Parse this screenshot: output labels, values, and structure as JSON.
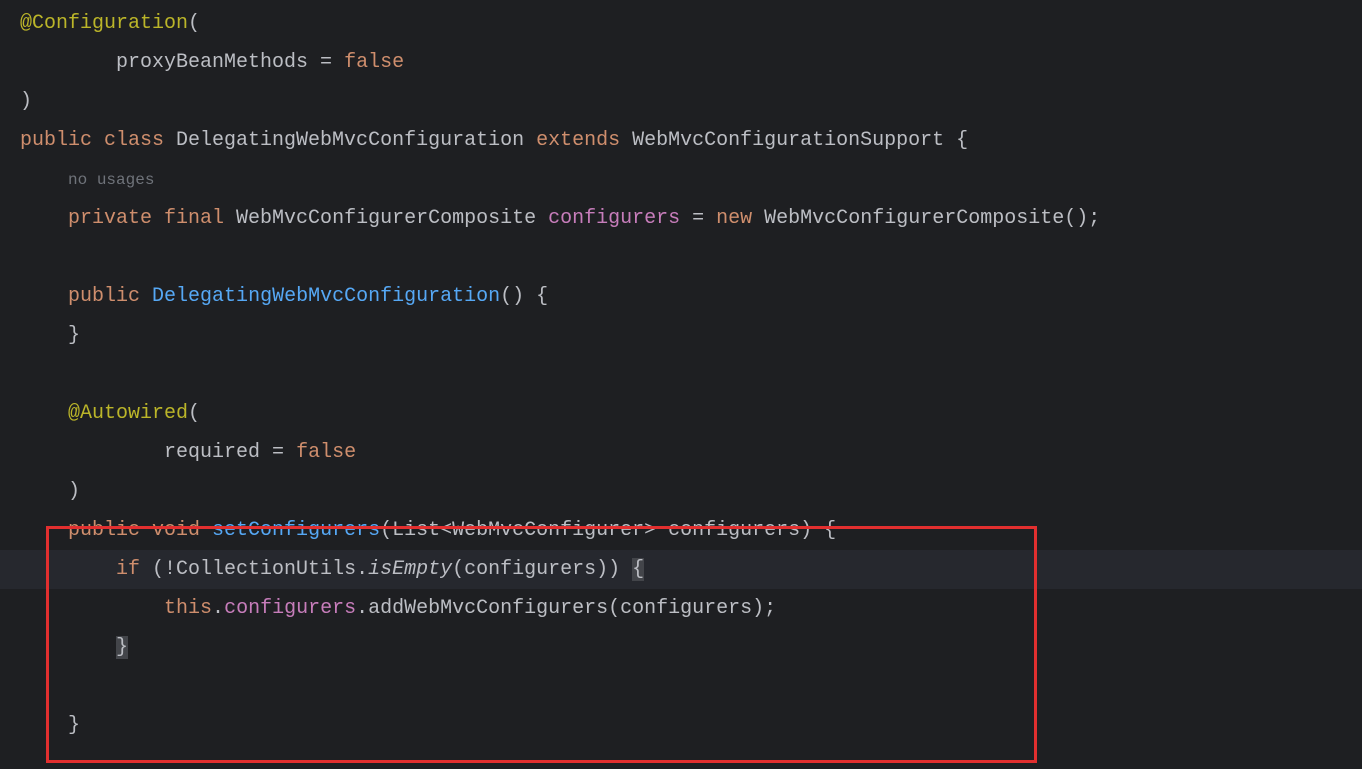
{
  "code": {
    "l1_annotation": "@Configuration",
    "l1_paren": "(",
    "l2_indent": "        ",
    "l2_prop": "proxyBeanMethods = ",
    "l2_val": "false",
    "l3": ")",
    "l4_public": "public",
    "l4_class": " class ",
    "l4_name": "DelegatingWebMvcConfiguration ",
    "l4_extends": "extends",
    "l4_super": " WebMvcConfigurationSupport {",
    "l5_indent": "    ",
    "l5_hint": "no usages",
    "l6_indent": "    ",
    "l6_private": "private",
    "l6_final": " final ",
    "l6_type": "WebMvcConfigurerComposite ",
    "l6_field": "configurers",
    "l6_eq": " = ",
    "l6_new": "new",
    "l6_ctor": " WebMvcConfigurerComposite();",
    "l7": "",
    "l8_indent": "    ",
    "l8_public": "public",
    "l8_sp": " ",
    "l8_ctor": "DelegatingWebMvcConfiguration",
    "l8_tail": "() {",
    "l9_indent": "    ",
    "l9_close": "}",
    "l10": "",
    "l11_indent": "    ",
    "l11_anno": "@Autowired",
    "l11_paren": "(",
    "l12_indent": "            ",
    "l12_prop": "required = ",
    "l12_val": "false",
    "l13_indent": "    ",
    "l13_close": ")",
    "l14_indent": "    ",
    "l14_public": "public",
    "l14_void": " void ",
    "l14_method": "setConfigurers",
    "l14_params": "(List<WebMvcConfigurer> configurers) {",
    "l15_indent": "        ",
    "l15_if": "if",
    "l15_cond1": " (!CollectionUtils.",
    "l15_isempty": "isEmpty",
    "l15_cond2": "(configurers)) ",
    "l15_brace": "{",
    "l16_indent": "            ",
    "l16_this": "this",
    "l16_dot": ".",
    "l16_field": "configurers",
    "l16_call": ".addWebMvcConfigurers(configurers);",
    "l17_indent": "        ",
    "l17_close": "}",
    "l18": "",
    "l19_indent": "    ",
    "l19_close": "}"
  }
}
